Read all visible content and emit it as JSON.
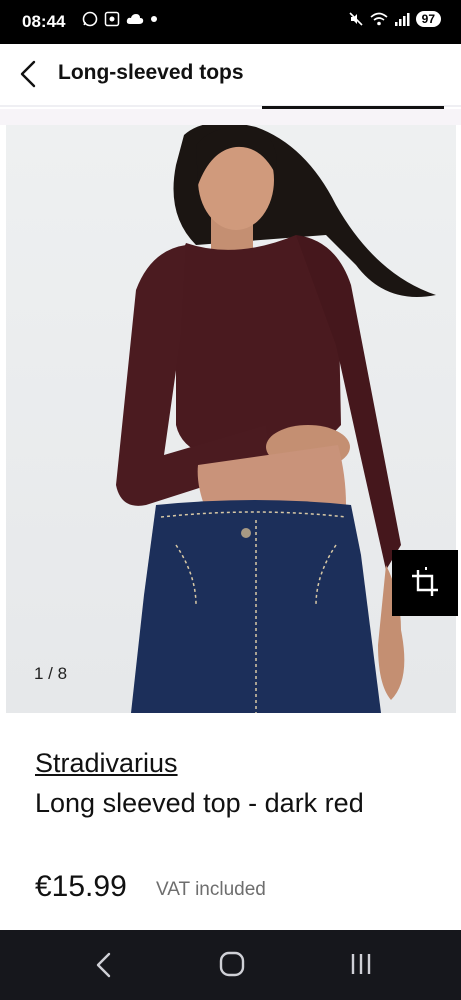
{
  "status_bar": {
    "time": "08:44",
    "battery": "97"
  },
  "header": {
    "title": "Long-sleeved tops"
  },
  "gallery": {
    "counter": "1 / 8"
  },
  "product": {
    "brand": "Stradivarius",
    "name": "Long sleeved top - dark red",
    "price": "€15.99",
    "vat_note": "VAT included"
  },
  "colors": {
    "shirt": "#4a1a1f",
    "jeans": "#1c2f5a",
    "nav_bg": "#16171c"
  },
  "icons": [
    "whatsapp-icon",
    "screen-record-icon",
    "cloud-icon",
    "mute-icon",
    "wifi-icon",
    "signal-icon",
    "back-arrow-icon",
    "crop-icon",
    "nav-back-icon",
    "nav-home-icon",
    "nav-recents-icon"
  ]
}
